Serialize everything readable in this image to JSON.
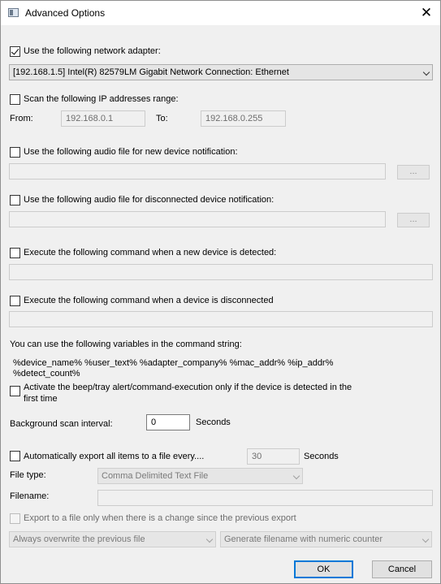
{
  "window": {
    "title": "Advanced Options",
    "close_glyph": "✕"
  },
  "adapter": {
    "checkbox_label": "Use the following network adapter:",
    "checked": true,
    "selected": "[192.168.1.5]  Intel(R) 82579LM Gigabit Network Connection:  Ethernet"
  },
  "ip_range": {
    "checkbox_label": "Scan the following IP addresses range:",
    "from_label": "From:",
    "from_value": "192.168.0.1",
    "to_label": "To:",
    "to_value": "192.168.0.255"
  },
  "audio_new": {
    "checkbox_label": "Use the following audio file for new device notification:",
    "browse_label": "..."
  },
  "audio_disconnected": {
    "checkbox_label": "Use the following audio file for disconnected device notification:",
    "browse_label": "..."
  },
  "cmd_new": {
    "checkbox_label": "Execute the following command when a new device is detected:"
  },
  "cmd_disconnected": {
    "checkbox_label": "Execute the following command when a device is disconnected"
  },
  "variables": {
    "intro": "You can use the following variables in the command string:",
    "line1": "%device_name%  %user_text%  %adapter_company%  %mac_addr%  %ip_addr%",
    "line2": "%detect_count%"
  },
  "first_time": {
    "label_line1": "Activate the beep/tray alert/command-execution only if the device is detected in the",
    "label_line2": "first time"
  },
  "scan_interval": {
    "label": "Background scan interval:",
    "value": "0",
    "unit": "Seconds"
  },
  "auto_export": {
    "checkbox_label": "Automatically export all items to a file every....",
    "value": "30",
    "unit": "Seconds",
    "file_type_label": "File type:",
    "file_type_value": "Comma Delimited Text File",
    "filename_label": "Filename:",
    "filename_value": "",
    "only_change_label": "Export to a file only when there is a change since the previous export",
    "overwrite_value": "Always overwrite the previous file",
    "filename_mode_value": "Generate filename with numeric counter"
  },
  "buttons": {
    "ok": "OK",
    "cancel": "Cancel"
  },
  "colors": {
    "accent": "#0078d7",
    "window_bg": "#f0f0f0"
  }
}
